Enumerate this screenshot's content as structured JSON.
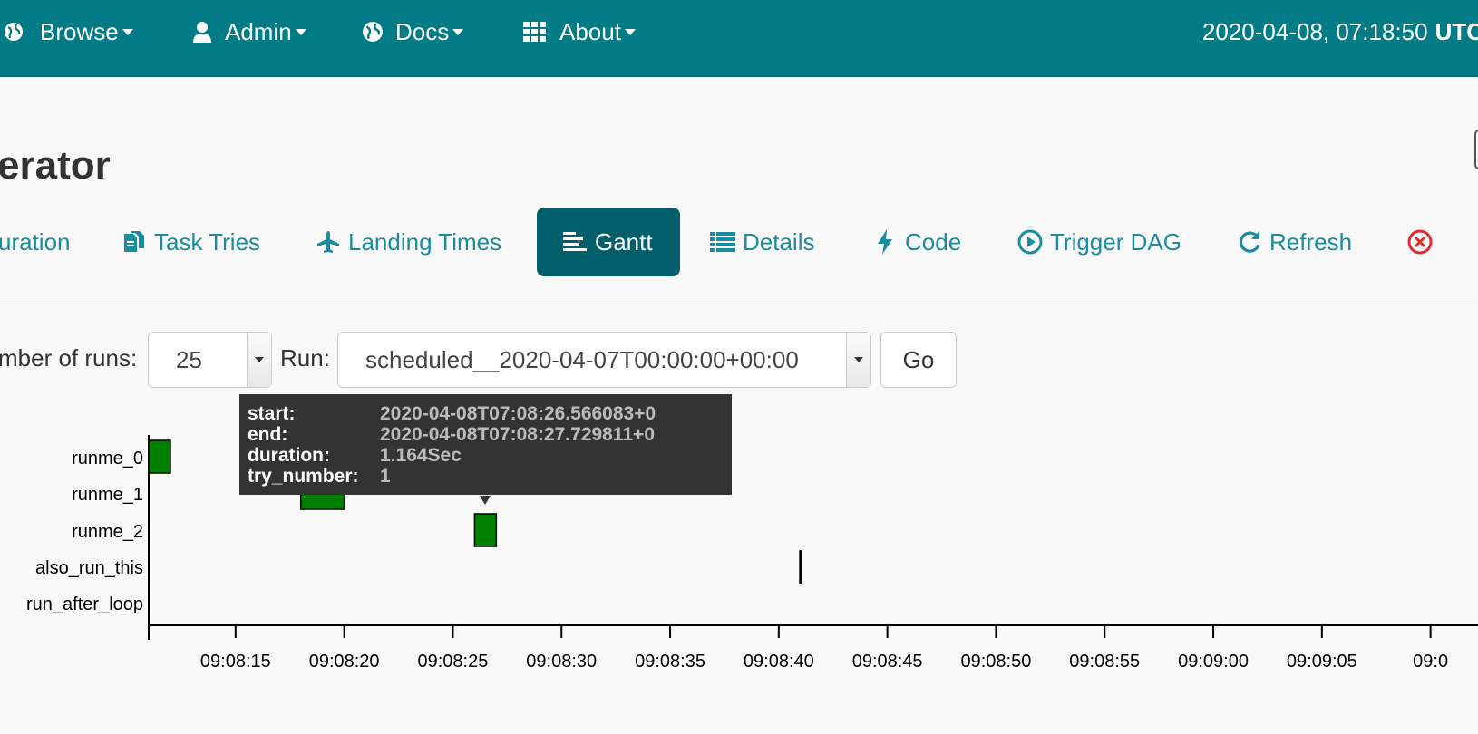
{
  "navbar": {
    "items": [
      {
        "label": "Browse",
        "icon": "globe-icon"
      },
      {
        "label": "Admin",
        "icon": "user-icon"
      },
      {
        "label": "Docs",
        "icon": "globe-icon"
      },
      {
        "label": "About",
        "icon": "grid-icon"
      }
    ],
    "clock": "2020-04-08, 07:18:50",
    "timezone": "UTC"
  },
  "page": {
    "title": "erator"
  },
  "tabs": [
    {
      "label": "uration",
      "icon": ""
    },
    {
      "label": "Task Tries",
      "icon": "files-icon"
    },
    {
      "label": "Landing Times",
      "icon": "plane-icon"
    },
    {
      "label": "Gantt",
      "icon": "gantt-icon"
    },
    {
      "label": "Details",
      "icon": "list-icon"
    },
    {
      "label": "Code",
      "icon": "bolt-icon"
    },
    {
      "label": "Trigger DAG",
      "icon": "play-circle-icon"
    },
    {
      "label": "Refresh",
      "icon": "refresh-icon"
    }
  ],
  "form": {
    "num_runs_label": "mber of runs:",
    "num_runs_value": "25",
    "run_label": "Run:",
    "run_value": "scheduled__2020-04-07T00:00:00+00:00",
    "go_label": "Go"
  },
  "tooltip": {
    "start_label": "start:",
    "start_value": "2020-04-08T07:08:26.566083+0",
    "end_label": "end:",
    "end_value": "2020-04-08T07:08:27.729811+0",
    "duration_label": "duration:",
    "duration_value": "1.164Sec",
    "try_label": "try_number:",
    "try_value": "1"
  },
  "colors": {
    "navbar": "#017b86",
    "active_tab": "#005f6b",
    "link": "#1a8ba0",
    "bar_success": "#008000",
    "danger": "#e02b2b"
  },
  "chart_data": {
    "type": "gantt",
    "x_axis_start": "09:08:11",
    "x_ticks": [
      "09:08:15",
      "09:08:20",
      "09:08:25",
      "09:08:30",
      "09:08:35",
      "09:08:40",
      "09:08:45",
      "09:08:50",
      "09:08:55",
      "09:09:00",
      "09:09:05",
      "09:0"
    ],
    "tasks": [
      {
        "name": "runme_0",
        "start": "09:08:11",
        "end": "09:08:12",
        "state": "success"
      },
      {
        "name": "runme_1",
        "start": "09:08:18",
        "end": "09:08:20",
        "state": "success"
      },
      {
        "name": "runme_2",
        "start": "09:08:26",
        "end": "09:08:27",
        "state": "success"
      },
      {
        "name": "also_run_this",
        "start": "09:08:41",
        "end": "09:08:41",
        "state": "success"
      },
      {
        "name": "run_after_loop",
        "start": "",
        "end": "",
        "state": ""
      }
    ]
  }
}
